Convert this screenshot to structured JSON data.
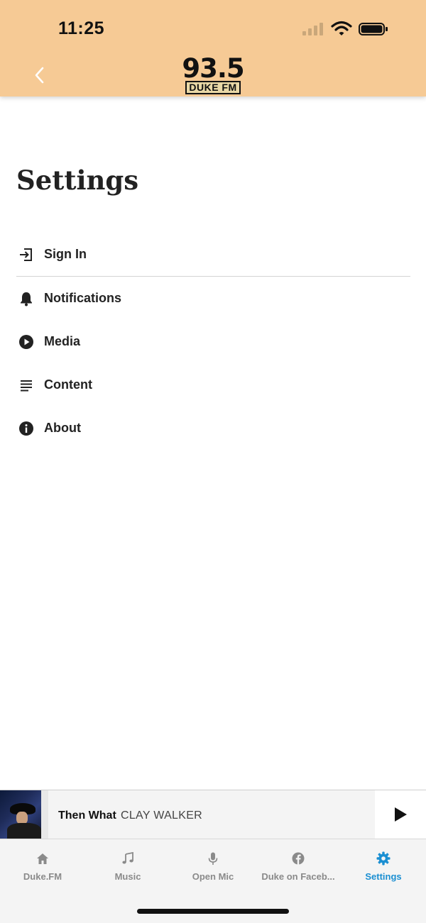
{
  "status_bar": {
    "time": "11:25"
  },
  "header": {
    "logo_number": "93.5",
    "logo_brand": "DUKE FM"
  },
  "page": {
    "title": "Settings"
  },
  "menu": {
    "items": [
      {
        "label": "Sign In",
        "icon": "sign-in-icon"
      },
      {
        "label": "Notifications",
        "icon": "bell-icon"
      },
      {
        "label": "Media",
        "icon": "play-circle-icon"
      },
      {
        "label": "Content",
        "icon": "text-lines-icon"
      },
      {
        "label": "About",
        "icon": "info-icon"
      }
    ]
  },
  "now_playing": {
    "title": "Then What",
    "artist": "CLAY WALKER"
  },
  "tabs": [
    {
      "label": "Duke.FM",
      "icon": "home-icon",
      "active": false
    },
    {
      "label": "Music",
      "icon": "music-note-icon",
      "active": false
    },
    {
      "label": "Open Mic",
      "icon": "microphone-icon",
      "active": false
    },
    {
      "label": "Duke on Faceb...",
      "icon": "facebook-icon",
      "active": false
    },
    {
      "label": "Settings",
      "icon": "gear-icon",
      "active": true
    }
  ],
  "colors": {
    "header_bg": "#f6ca95",
    "accent": "#1b8fd2",
    "inactive_tab": "#8a8a8a"
  }
}
